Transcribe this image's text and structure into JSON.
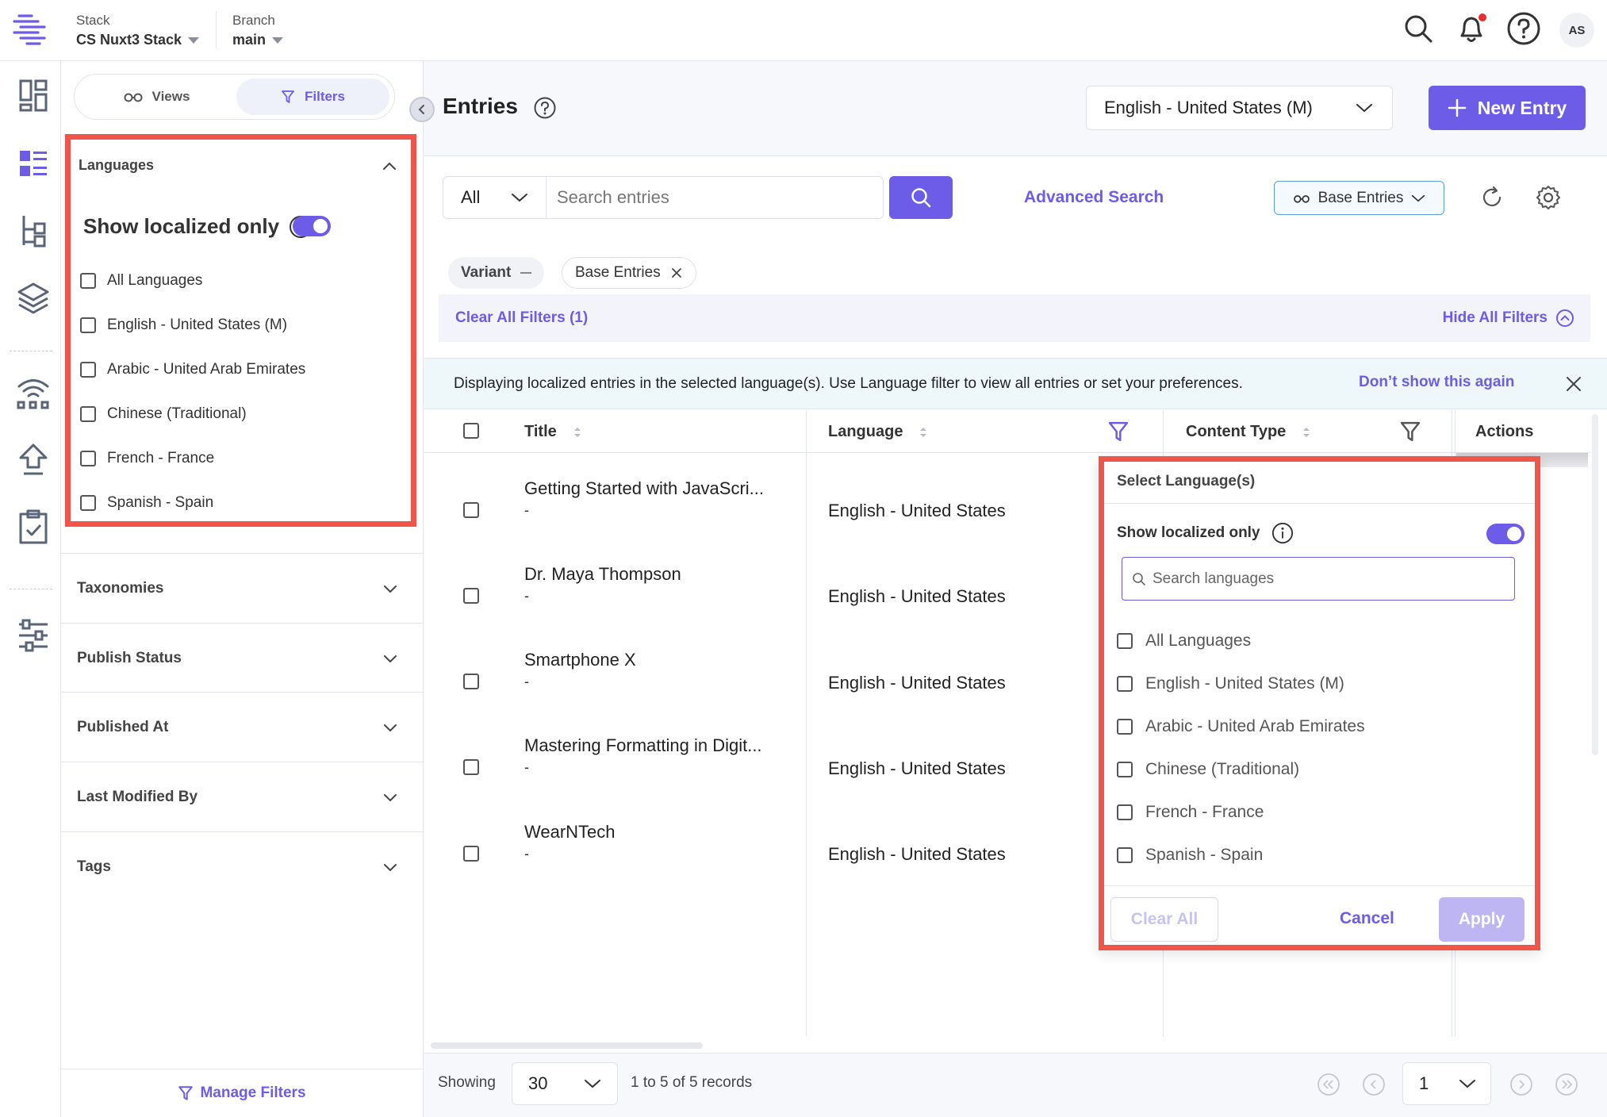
{
  "header": {
    "stack_label": "Stack",
    "stack_value": "CS Nuxt3 Stack",
    "branch_label": "Branch",
    "branch_value": "main",
    "avatar": "AS"
  },
  "rail": {
    "icons": [
      "dashboard-icon",
      "entries-icon",
      "content-models-icon",
      "assets-icon",
      "deployments-icon",
      "releases-icon",
      "tasks-icon",
      "settings-sliders-icon"
    ]
  },
  "sidebar": {
    "views_label": "Views",
    "filters_label": "Filters",
    "languages_header": "Languages",
    "show_localized": "Show localized only",
    "languages": [
      "All Languages",
      "English - United States (M)",
      "Arabic - United Arab Emirates",
      "Chinese (Traditional)",
      "French - France",
      "Spanish - Spain"
    ],
    "sections": [
      "Taxonomies",
      "Publish Status",
      "Published At",
      "Last Modified By",
      "Tags"
    ],
    "manage_filters": "Manage Filters"
  },
  "main": {
    "title": "Entries",
    "locale": "English - United States (M)",
    "new_entry": "New Entry",
    "search_scope": "All",
    "search_placeholder": "Search entries",
    "advanced_search": "Advanced Search",
    "base_entries": "Base Entries",
    "chips": {
      "variant": "Variant",
      "base": "Base Entries"
    },
    "clear_filters": "Clear All Filters (1)",
    "hide_filters": "Hide All Filters",
    "notice": "Displaying localized entries in the selected language(s). Use Language filter to view all entries or set your preferences.",
    "notice_link": "Don’t show this again"
  },
  "table": {
    "columns": {
      "title": "Title",
      "language": "Language",
      "content_type": "Content Type",
      "actions": "Actions"
    },
    "rows": [
      {
        "title": "Getting Started with JavaScri...",
        "sub": "-",
        "language": "English - United States"
      },
      {
        "title": "Dr. Maya Thompson",
        "sub": "-",
        "language": "English - United States"
      },
      {
        "title": "Smartphone X",
        "sub": "-",
        "language": "English - United States"
      },
      {
        "title": "Mastering Formatting in Digit...",
        "sub": "-",
        "language": "English - United States"
      },
      {
        "title": "WearNTech",
        "sub": "-",
        "language": "English - United States"
      }
    ]
  },
  "pager": {
    "showing": "Showing",
    "per_page": "30",
    "records": "1 to 5 of 5 records",
    "page": "1"
  },
  "popover": {
    "title": "Select Language(s)",
    "show_localized": "Show localized only",
    "search_placeholder": "Search languages",
    "languages": [
      "All Languages",
      "English - United States (M)",
      "Arabic - United Arab Emirates",
      "Chinese (Traditional)",
      "French - France",
      "Spanish - Spain"
    ],
    "clear_all": "Clear All",
    "cancel": "Cancel",
    "apply": "Apply"
  },
  "colors": {
    "accent": "#6c5ce7",
    "highlight_border": "#f0554a",
    "notice_bg": "#eef8fb"
  }
}
